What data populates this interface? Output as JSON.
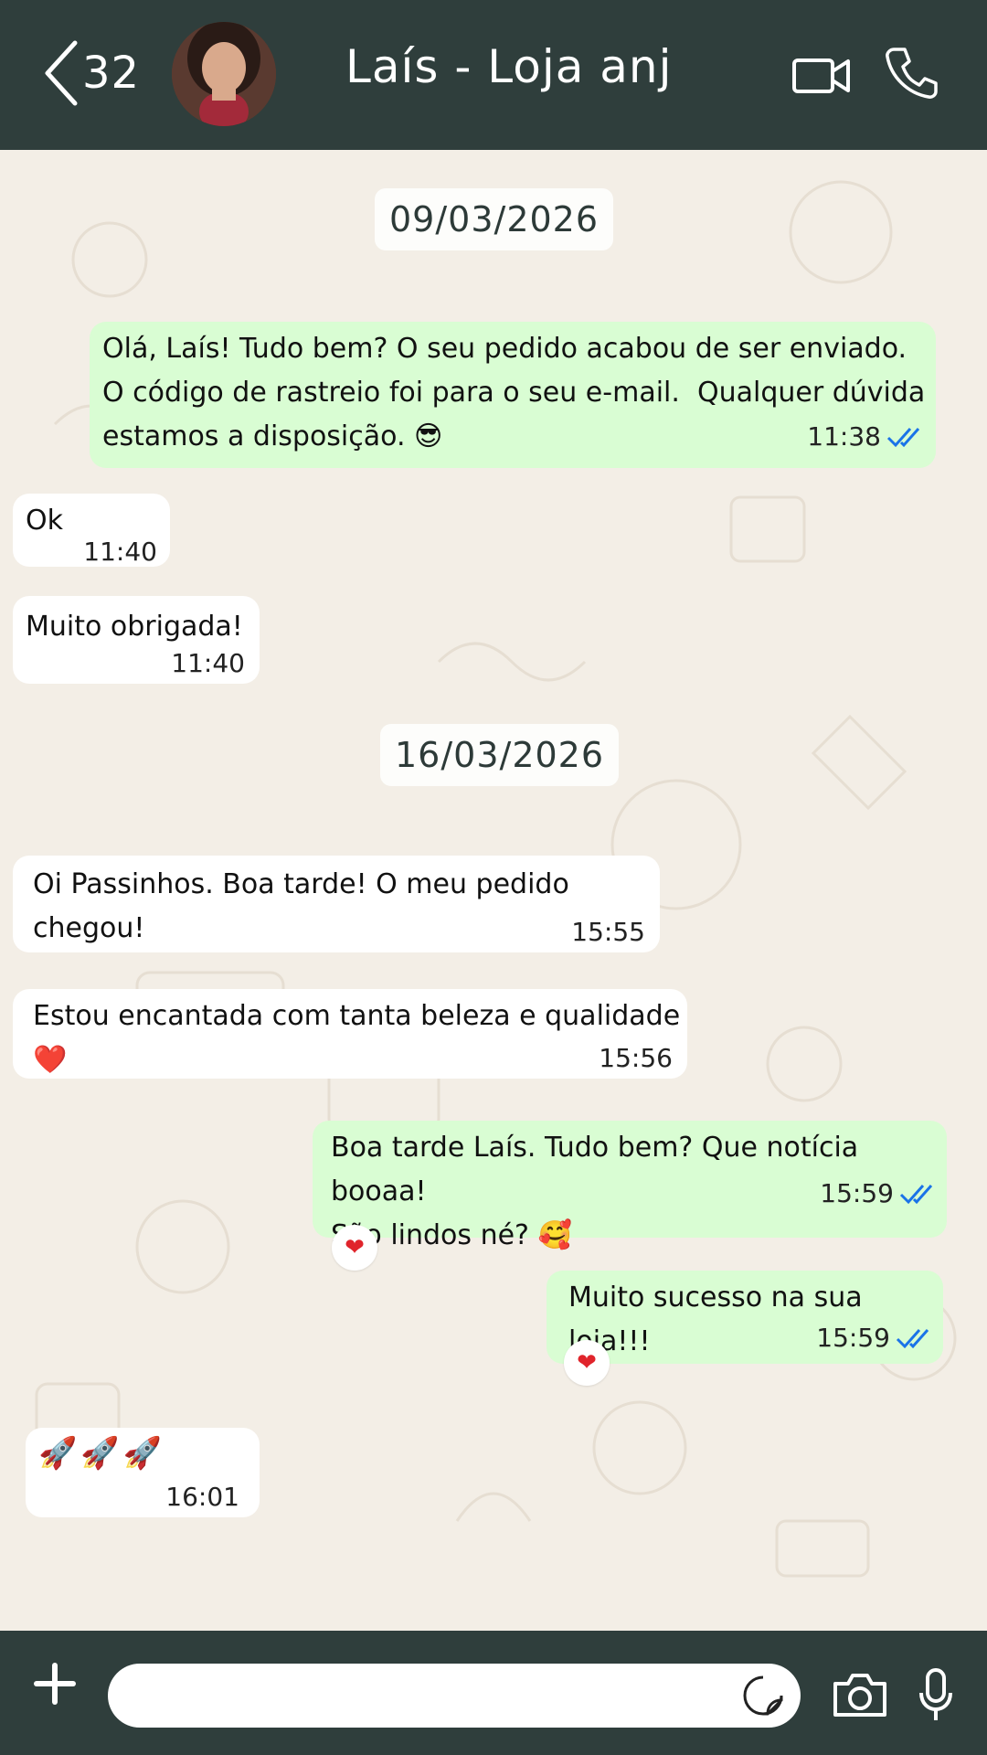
{
  "header": {
    "back_count": "32",
    "contact_name": "Laís - Loja anj",
    "icons": [
      "back-chevron-icon",
      "video-call-icon",
      "phone-call-icon"
    ]
  },
  "chat": {
    "dates": [
      "09/03/2026",
      "16/03/2026"
    ],
    "messages": [
      {
        "dir": "out",
        "text": "Olá, Laís! Tudo bem? O seu pedido acabou de ser enviado.\nO código de rastreio foi para o seu e-mail.  Qualquer dúvida\nestamos a disposição. 😎",
        "time": "11:38",
        "status": "read"
      },
      {
        "dir": "in",
        "text": "Ok",
        "time": "11:40"
      },
      {
        "dir": "in",
        "text": "Muito obrigada!",
        "time": "11:40"
      },
      {
        "dir": "in",
        "text": "Oi Passinhos. Boa tarde! O meu pedido chegou!",
        "time": "15:55"
      },
      {
        "dir": "in",
        "text": "Estou encantada com tanta beleza e qualidade ❤️",
        "time": "15:56"
      },
      {
        "dir": "out",
        "text": "Boa tarde Laís. Tudo bem? Que notícia booaa!\nSão lindos né? 🥰",
        "time": "15:59",
        "status": "read",
        "reaction": "❤"
      },
      {
        "dir": "out",
        "text": "Muito sucesso na sua loja!!!",
        "time": "15:59",
        "status": "read",
        "reaction": "❤"
      },
      {
        "dir": "in",
        "text": "🚀🚀🚀",
        "time": "16:01"
      }
    ]
  },
  "footer": {
    "message_placeholder": "",
    "icons": [
      "plus-icon",
      "sticker-icon",
      "camera-icon",
      "microphone-icon"
    ]
  },
  "colors": {
    "header_bg": "#2f3e3c",
    "chat_bg": "#f3eee6",
    "outgoing_bubble": "#d9fdd3",
    "incoming_bubble": "#ffffff",
    "read_tick": "#1a73e8"
  }
}
